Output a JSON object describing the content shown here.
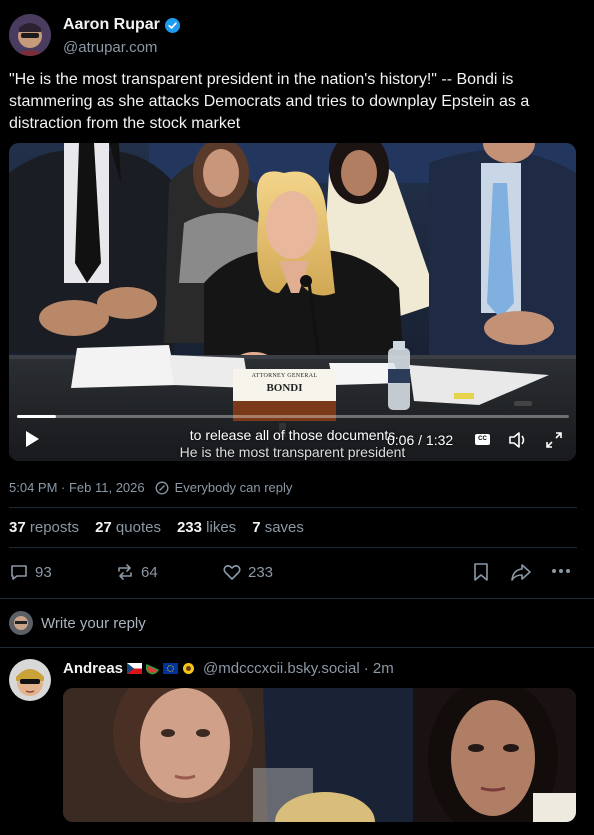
{
  "post": {
    "author_name": "Aaron Rupar",
    "author_handle": "@atrupar.com",
    "text": "\"He is the most transparent president in the nation's history!\" -- Bondi is stammering as she attacks Democrats and tries to downplay Epstein as a distraction from the stock market",
    "timestamp": "5:04 PM · Feb 11, 2026",
    "reply_setting": "Everybody can reply"
  },
  "video": {
    "placard_line1": "ATTORNEY GENERAL",
    "placard_line2": "BONDI",
    "caption_line1": "to release all of those documents",
    "caption_line2": "He is the most transparent president",
    "time": "0:06 / 1:32",
    "progress": 0.07,
    "cc_label": "CC"
  },
  "stats": {
    "reposts_count": "37",
    "reposts_label": "reposts",
    "quotes_count": "27",
    "quotes_label": "quotes",
    "likes_count": "233",
    "likes_label": "likes",
    "saves_count": "7",
    "saves_label": "saves"
  },
  "actions": {
    "reply_count": "93",
    "repost_count": "64",
    "like_count": "233"
  },
  "reply_box": {
    "placeholder": "Write your reply"
  },
  "reply": {
    "author_name": "Andreas",
    "author_handle": "@mdcccxcii.bsky.social",
    "time": "· 2m"
  },
  "colors": {
    "background": "#000000",
    "accent": "#1d9bf0",
    "muted_text": "#8b98a5"
  }
}
